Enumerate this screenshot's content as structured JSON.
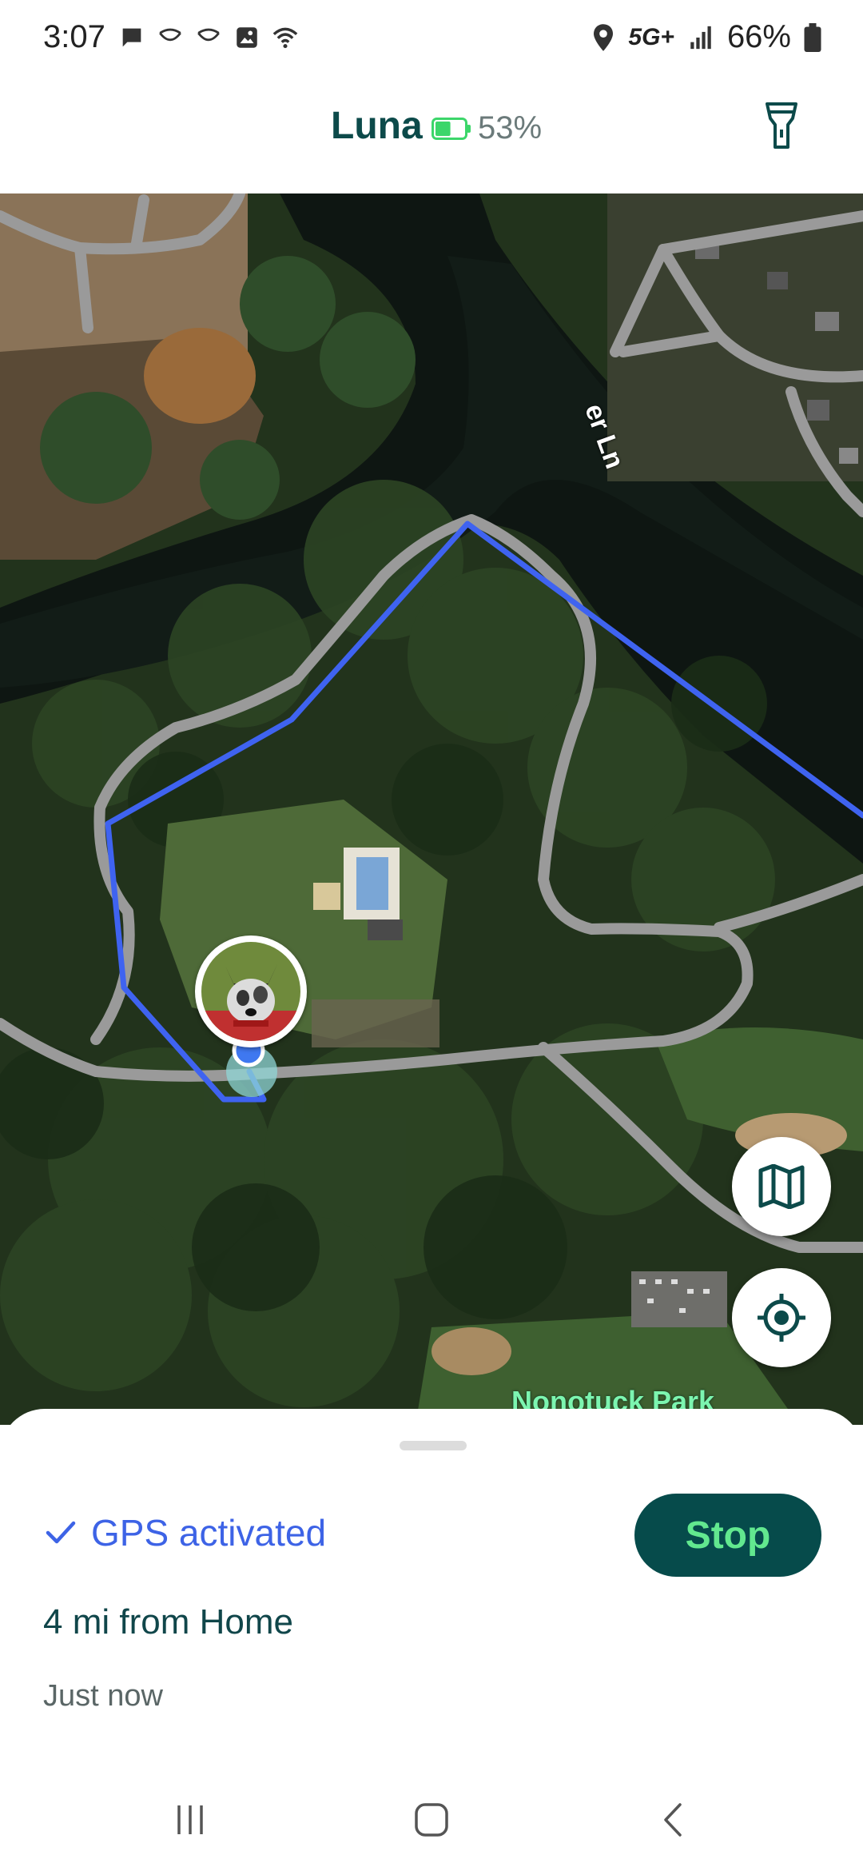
{
  "status_bar": {
    "time": "3:07",
    "network": "5G+",
    "battery": "66%",
    "icons": [
      "chat-icon",
      "voicemail-icon",
      "voicemail-icon",
      "gallery-icon",
      "wifi-icon",
      "location-icon",
      "signal-icon",
      "battery-icon"
    ]
  },
  "header": {
    "pet_name": "Luna",
    "tracker_battery": "53%",
    "tracker_battery_level": 0.53,
    "accent_color": "#0c4a4a",
    "battery_color": "#3cd66a"
  },
  "map": {
    "street_label": "er Ln",
    "park_label": "Nonotuck Park",
    "track_color": "#3f63f0",
    "road_color": "#9a9a9a"
  },
  "sheet": {
    "gps_status": "GPS activated",
    "stop_label": "Stop",
    "distance": "4 mi from Home",
    "updated": "Just now",
    "gps_color": "#3d63e6",
    "stop_bg": "#064b4b",
    "stop_text_color": "#62e88f"
  }
}
